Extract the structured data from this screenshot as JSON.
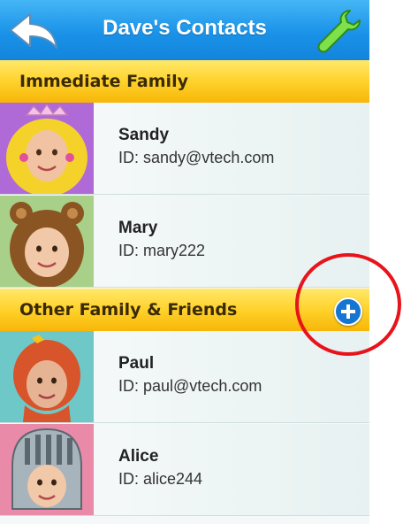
{
  "header": {
    "title": "Dave's Contacts",
    "back_icon": "back-arrow-icon",
    "settings_icon": "wrench-icon",
    "color": "#1a92e8"
  },
  "sections": [
    {
      "label": "Immediate Family",
      "contacts": [
        {
          "name": "Sandy",
          "id": "ID: sandy@vtech.com",
          "avatar": "princess-avatar"
        },
        {
          "name": "Mary",
          "id": "ID: mary222",
          "avatar": "bear-avatar"
        }
      ]
    },
    {
      "label": "Other Family & Friends",
      "add_icon": "plus-circle-icon",
      "contacts": [
        {
          "name": "Paul",
          "id": "ID: paul@vtech.com",
          "avatar": "redhead-avatar"
        },
        {
          "name": "Alice",
          "id": "ID: alice244",
          "avatar": "knight-avatar"
        }
      ]
    }
  ],
  "colors": {
    "section_bar": "#ffd22c",
    "highlight_circle": "#e8141c"
  }
}
